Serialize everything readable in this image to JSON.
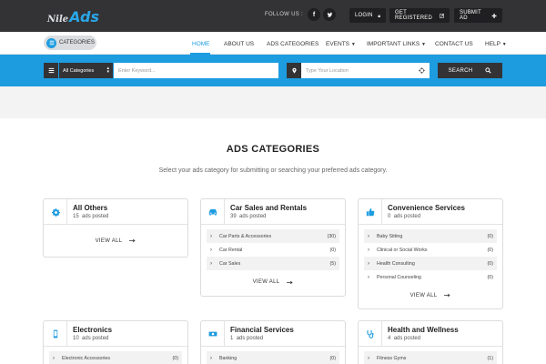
{
  "brand": {
    "logo_part1": "Nile",
    "logo_part2": "Ads"
  },
  "topbar": {
    "follow_label": "FOLLOW US :",
    "social": [
      {
        "icon": "facebook-icon",
        "glyph": "f"
      },
      {
        "icon": "twitter-icon",
        "glyph": "t"
      }
    ],
    "buttons": [
      {
        "label": "LOGIN",
        "icon": "lock-icon"
      },
      {
        "label": "GET REGISTERED",
        "icon": "edit-icon"
      },
      {
        "label": "SUBMIT AD",
        "icon": "plus-icon"
      }
    ]
  },
  "nav": {
    "categories_button": "CATEGORIES",
    "items": [
      {
        "label": "HOME",
        "active": true
      },
      {
        "label": "ABOUT US"
      },
      {
        "label": "ADS CATEGORIES"
      },
      {
        "label": "EVENTS",
        "dropdown": true
      },
      {
        "label": "IMPORTANT LINKS",
        "dropdown": true
      },
      {
        "label": "CONTACT US"
      },
      {
        "label": "HELP",
        "dropdown": true
      }
    ]
  },
  "search": {
    "category_select": "All Categories",
    "keyword_placeholder": "Enter Keyword...",
    "location_placeholder": "Type Your Location",
    "button_label": "SEARCH"
  },
  "section": {
    "title": "ADS CATEGORIES",
    "subtitle": "Select your ads category for submitting or searching your preferred ads category."
  },
  "view_all_label": "VIEW ALL",
  "colors": {
    "accent": "#1d9ce0",
    "dark": "#333336"
  },
  "categories": [
    {
      "title": "All Others",
      "count": "15",
      "count_suffix": "ads posted",
      "icon": "gear-icon",
      "subs": []
    },
    {
      "title": "Car Sales and Rentals",
      "count": "39",
      "count_suffix": "ads posted",
      "icon": "car-icon",
      "subs": [
        {
          "name": "Car Parts & Accessories",
          "count": "(30)"
        },
        {
          "name": "Car Rental",
          "count": "(0)"
        },
        {
          "name": "Car Sales",
          "count": "(5)"
        }
      ]
    },
    {
      "title": "Convenience Services",
      "count": "0",
      "count_suffix": "ads posted",
      "icon": "thumbs-up-icon",
      "subs": [
        {
          "name": "Baby Sitting",
          "count": "(0)"
        },
        {
          "name": "Clinical or Social Works",
          "count": "(0)"
        },
        {
          "name": "Health Consulting",
          "count": "(0)"
        },
        {
          "name": "Personal Counseling",
          "count": "(0)"
        }
      ]
    },
    {
      "title": "Electronics",
      "count": "10",
      "count_suffix": "ads posted",
      "icon": "mobile-icon",
      "subs": [
        {
          "name": "Electronic Accessories",
          "count": "(0)"
        }
      ]
    },
    {
      "title": "Financial Services",
      "count": "1",
      "count_suffix": "ads posted",
      "icon": "money-icon",
      "subs": [
        {
          "name": "Banking",
          "count": "(0)"
        }
      ]
    },
    {
      "title": "Health and Wellness",
      "count": "4",
      "count_suffix": "ads posted",
      "icon": "stethoscope-icon",
      "subs": [
        {
          "name": "Fitness Gyms",
          "count": "(1)"
        }
      ]
    }
  ]
}
